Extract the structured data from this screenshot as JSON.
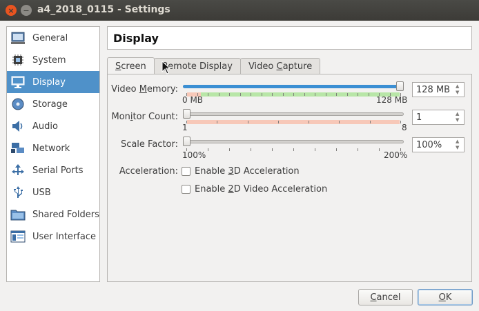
{
  "window": {
    "title": "a4_2018_0115 - Settings",
    "close_glyph": "×",
    "minimize_glyph": "−"
  },
  "sidebar": {
    "items": [
      {
        "label": "General",
        "icon": "general-icon",
        "active": false
      },
      {
        "label": "System",
        "icon": "system-icon",
        "active": false
      },
      {
        "label": "Display",
        "icon": "display-icon",
        "active": true
      },
      {
        "label": "Storage",
        "icon": "storage-icon",
        "active": false
      },
      {
        "label": "Audio",
        "icon": "audio-icon",
        "active": false
      },
      {
        "label": "Network",
        "icon": "network-icon",
        "active": false
      },
      {
        "label": "Serial Ports",
        "icon": "serial-ports-icon",
        "active": false
      },
      {
        "label": "USB",
        "icon": "usb-icon",
        "active": false
      },
      {
        "label": "Shared Folders",
        "icon": "shared-folders-icon",
        "active": false
      },
      {
        "label": "User Interface",
        "icon": "user-interface-icon",
        "active": false
      }
    ]
  },
  "header": {
    "title": "Display"
  },
  "tabs": [
    {
      "label": "Screen",
      "mnemonic_index": 0,
      "active": true
    },
    {
      "label": "Remote Display",
      "mnemonic_index": 0,
      "active": false
    },
    {
      "label": "Video Capture",
      "mnemonic_index": 6,
      "active": false
    }
  ],
  "screen": {
    "video_memory": {
      "label": "Video Memory:",
      "mnemonic_index": 6,
      "min_label": "0 MB",
      "max_label": "128 MB",
      "value_text": "128 MB",
      "fraction": 1.0
    },
    "monitor_count": {
      "label": "Monitor Count:",
      "mnemonic_index": 3,
      "min_label": "1",
      "max_label": "8",
      "value_text": "1",
      "fraction": 0.0
    },
    "scale_factor": {
      "label": "Scale Factor:",
      "min_label": "100%",
      "max_label": "200%",
      "value_text": "100%",
      "fraction": 0.0
    },
    "acceleration": {
      "label": "Acceleration:",
      "options": [
        {
          "label": "Enable 3D Acceleration",
          "mnemonic_index": 7,
          "checked": false
        },
        {
          "label": "Enable 2D Video Acceleration",
          "mnemonic_index": 7,
          "checked": false
        }
      ]
    }
  },
  "buttons": {
    "cancel": "Cancel",
    "ok": "OK"
  },
  "colors": {
    "accent": "#4f91c9",
    "slider_fill": "#3b8fd3",
    "zone_good": "#b8e6a7",
    "zone_bad": "#f7c8b8"
  }
}
